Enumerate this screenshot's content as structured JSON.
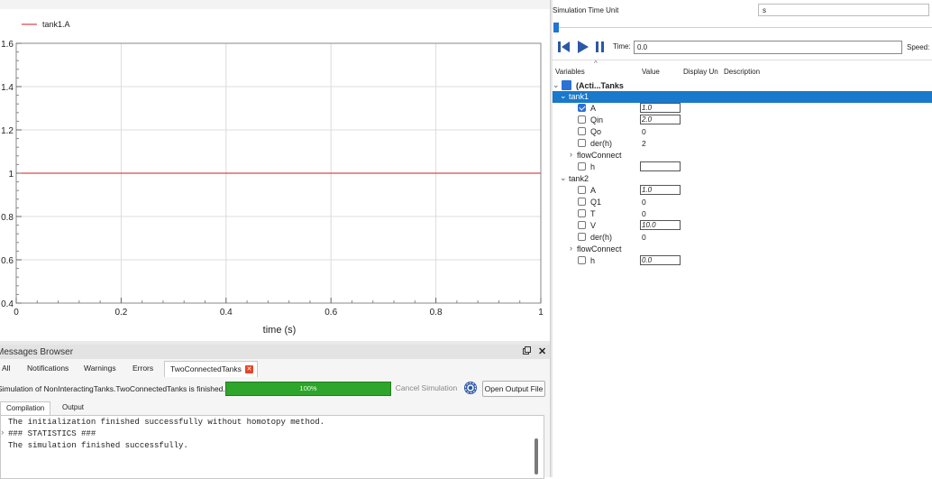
{
  "plot": {
    "legend": "tank1.A",
    "x_title": "time (s)"
  },
  "chart_data": {
    "type": "line",
    "xlabel": "time (s)",
    "ylabel": "",
    "xlim": [
      0,
      1
    ],
    "ylim": [
      0.4,
      1.6
    ],
    "x_ticks": [
      "0",
      "0.2",
      "0.4",
      "0.6",
      "0.8",
      "1"
    ],
    "y_ticks": [
      "0.4",
      "0.6",
      "0.8",
      "1",
      "1.2",
      "1.4",
      "1.6"
    ],
    "grid": true,
    "legend_position": "top-left",
    "series": [
      {
        "name": "tank1.A",
        "color": "#d01e1e",
        "x": [
          0,
          1
        ],
        "y": [
          1,
          1
        ]
      }
    ]
  },
  "messages": {
    "title": "Messages Browser",
    "float_icon": "float-icon",
    "close": "✕",
    "tabs": [
      "All",
      "Notifications",
      "Warnings",
      "Errors",
      "TwoConnectedTanks"
    ],
    "status": "Simulation of NonInteractingTanks.TwoConnectedTanks is finished.",
    "progress_pct": 100,
    "progress_label": "100%",
    "cancel_label": "Cancel Simulation",
    "open_output_label": "Open Output File",
    "subtabs": [
      "Compilation",
      "Output"
    ],
    "output_lines": [
      "The initialization finished successfully without homotopy method.",
      "### STATISTICS ###",
      "The simulation finished successfully."
    ]
  },
  "sim_controls": {
    "time_unit_label": "Simulation Time Unit",
    "time_unit_value": "s",
    "time_label": "Time:",
    "time_value": "0.0",
    "speed_label": "Speed:"
  },
  "variables": {
    "headers": {
      "name": "Variables",
      "value": "Value",
      "display_unit": "Display Un",
      "description": "Description"
    },
    "root_label": "(Acti...Tanks",
    "tank1": {
      "label": "tank1",
      "rows": [
        {
          "name": "A",
          "value": "1.0",
          "editable": true,
          "checked": true
        },
        {
          "name": "Qin",
          "value": "2.0",
          "editable": true,
          "checked": false
        },
        {
          "name": "Qo",
          "value": "0",
          "editable": false,
          "checked": false
        },
        {
          "name": "der(h)",
          "value": "2",
          "editable": false,
          "checked": false
        }
      ],
      "flow_label": "flowConnect",
      "h_label": "h",
      "h_value": ""
    },
    "tank2": {
      "label": "tank2",
      "rows": [
        {
          "name": "A",
          "value": "1.0",
          "editable": true,
          "checked": false
        },
        {
          "name": "Q1",
          "value": "0",
          "editable": false,
          "checked": false
        },
        {
          "name": "T",
          "value": "0",
          "editable": false,
          "checked": false
        },
        {
          "name": "V",
          "value": "10.0",
          "editable": true,
          "checked": false
        },
        {
          "name": "der(h)",
          "value": "0",
          "editable": false,
          "checked": false
        }
      ],
      "flow_label": "flowConnect",
      "h_label": "h",
      "h_value": "0.0"
    }
  }
}
